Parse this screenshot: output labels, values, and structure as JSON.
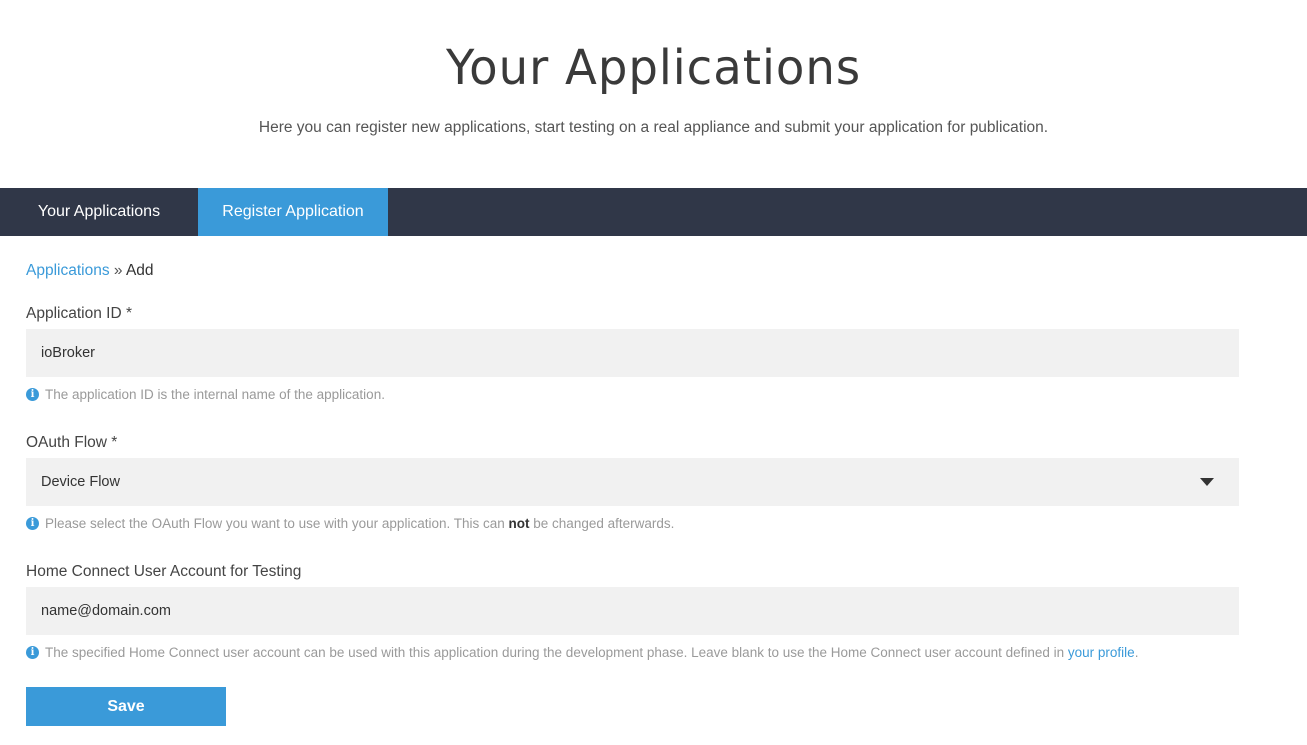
{
  "hero": {
    "title": "Your Applications",
    "subtitle": "Here you can register new applications, start testing on a real appliance and submit your application for publication."
  },
  "tabs": [
    {
      "label": "Your Applications",
      "active": false
    },
    {
      "label": "Register Application",
      "active": true
    }
  ],
  "breadcrumb": {
    "link": "Applications",
    "separator": "»",
    "current": "Add"
  },
  "form": {
    "app_id": {
      "label": "Application ID *",
      "value": "ioBroker",
      "help": "The application ID is the internal name of the application."
    },
    "oauth_flow": {
      "label": "OAuth Flow *",
      "selected": "Device Flow",
      "help_before": "Please select the OAuth Flow you want to use with your application. This can",
      "help_bold": "not",
      "help_after": "be changed afterwards."
    },
    "test_account": {
      "label": "Home Connect User Account for Testing",
      "value": "name@domain.com",
      "help_before": "The specified Home Connect user account can be used with this application during the development phase. Leave blank to use the Home Connect user account defined in",
      "help_link": "your profile",
      "help_after": "."
    },
    "save_label": "Save"
  },
  "icons": {
    "info": "info-circle-icon",
    "dropdown": "caret-down-icon"
  },
  "colors": {
    "accent": "#3a9ad9",
    "navbar": "#303748",
    "field_bg": "#f1f1f1"
  }
}
